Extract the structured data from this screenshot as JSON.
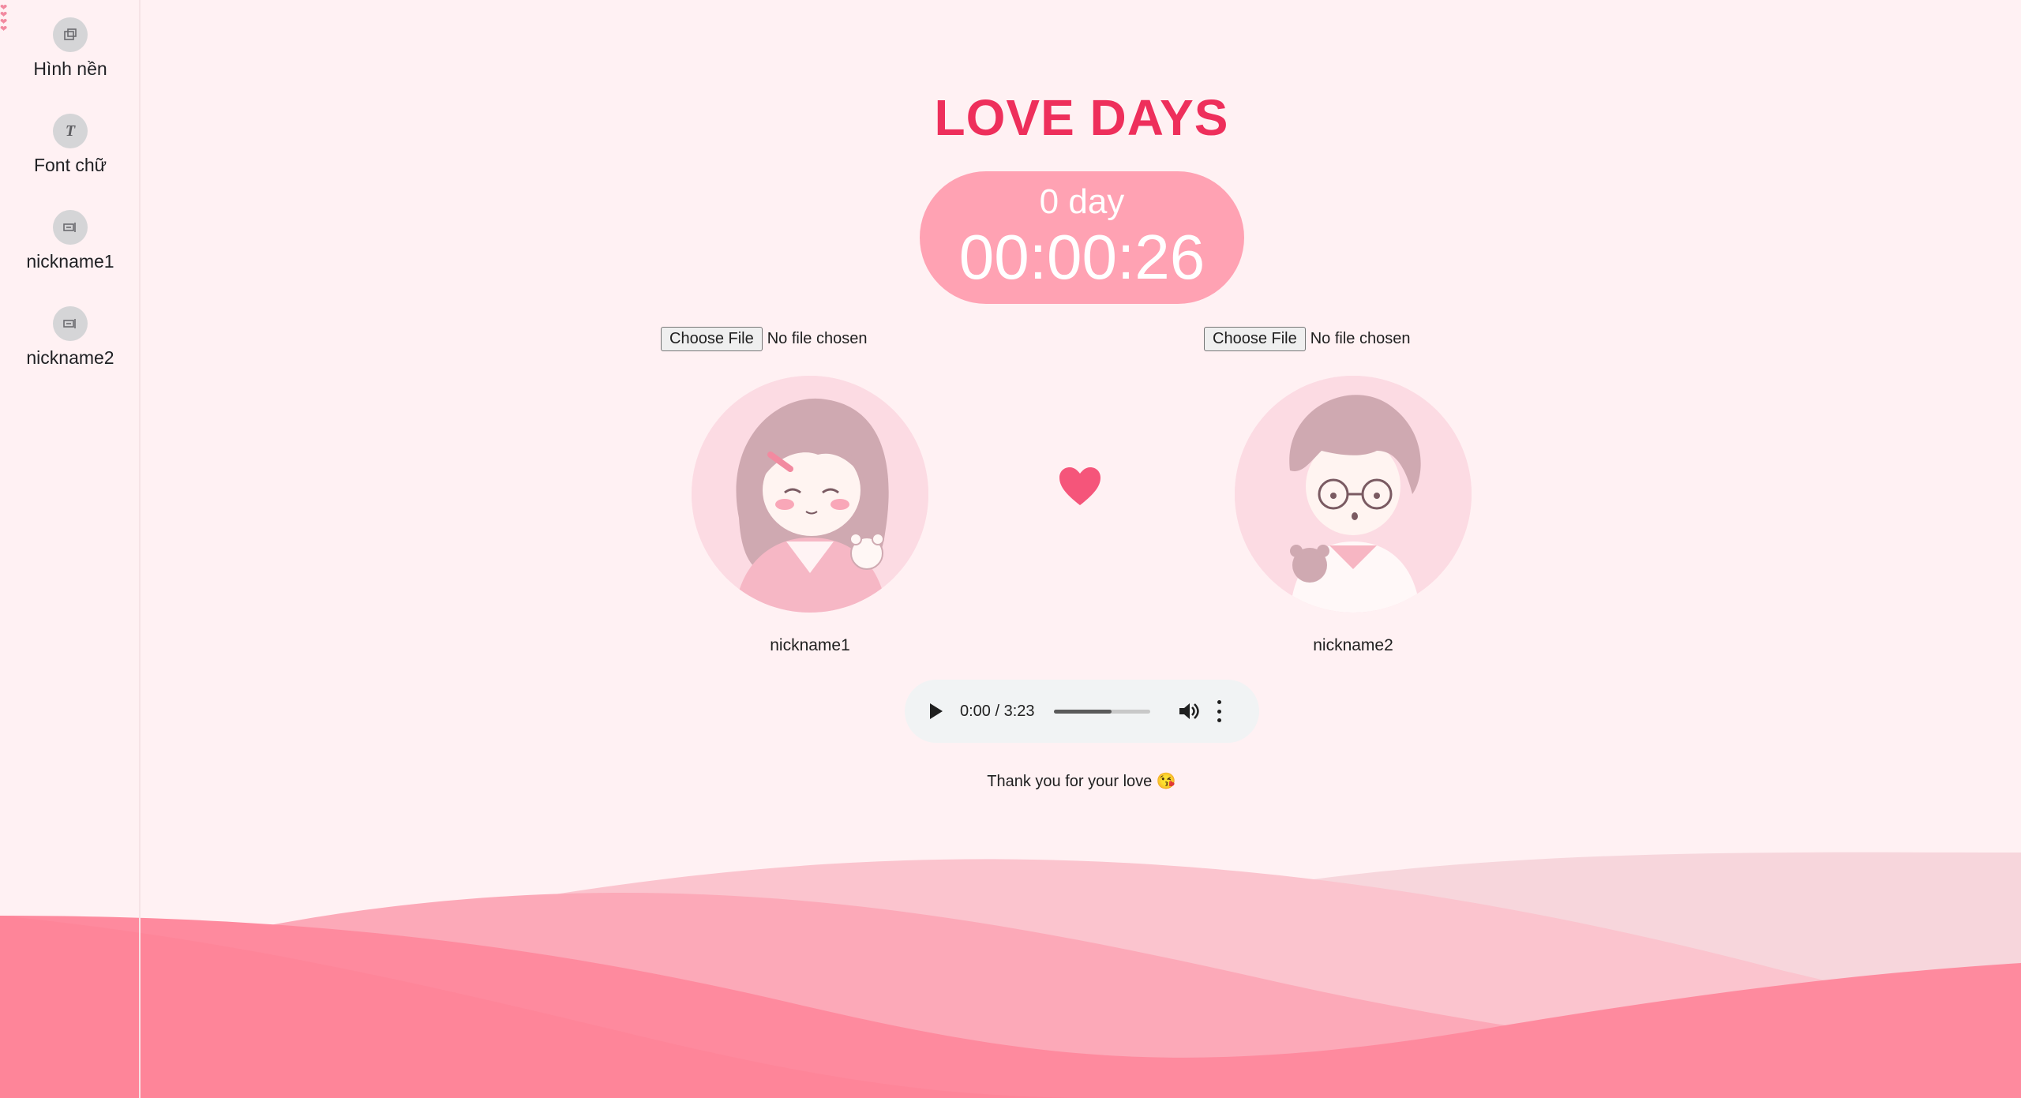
{
  "sidebar": {
    "items": [
      {
        "label": "Hình nền",
        "icon": "wallpaper-icon"
      },
      {
        "label": "Font chữ",
        "icon": "font-icon"
      },
      {
        "label": "nickname1",
        "icon": "rename-icon"
      },
      {
        "label": "nickname2",
        "icon": "rename-icon"
      }
    ]
  },
  "header": {
    "title": "LOVE DAYS"
  },
  "counter": {
    "days": "0 day",
    "time": "00:00:26"
  },
  "person1": {
    "file_button": "Choose File",
    "file_status": "No file chosen",
    "nickname": "nickname1",
    "avatar_icon": "girl-avatar-illustration"
  },
  "person2": {
    "file_button": "Choose File",
    "file_status": "No file chosen",
    "nickname": "nickname2",
    "avatar_icon": "boy-avatar-illustration"
  },
  "heart_icon": "heart-icon",
  "audio": {
    "time": "0:00 / 3:23",
    "progress": 0.6
  },
  "footer": {
    "message": "Thank you for your love 😘"
  },
  "colors": {
    "title": "#ee2f5b",
    "counter_bg": "#ffa2b3",
    "background": "#fff1f3",
    "heart": "#f5557a"
  }
}
